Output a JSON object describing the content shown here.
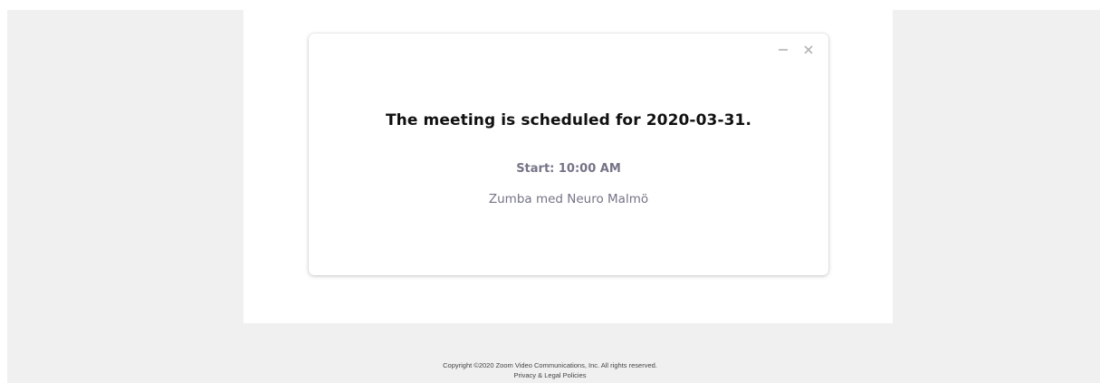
{
  "dialog": {
    "headline": "The meeting is scheduled for 2020-03-31.",
    "start": "Start: 10:00 AM",
    "topic": "Zumba med Neuro Malmö",
    "controls": {
      "minimize_icon": "minimize-icon",
      "close_icon": "close-icon"
    }
  },
  "footer": {
    "copyright": "Copyright ©2020 Zoom Video Communications, Inc. All rights reserved.",
    "privacy_link": "Privacy & Legal Policies"
  },
  "colors": {
    "page_background": "#f0f0f0",
    "panel_background": "#ffffff",
    "headline_text": "#111111",
    "secondary_text": "#747487",
    "control_icon": "#b3b3b3"
  }
}
